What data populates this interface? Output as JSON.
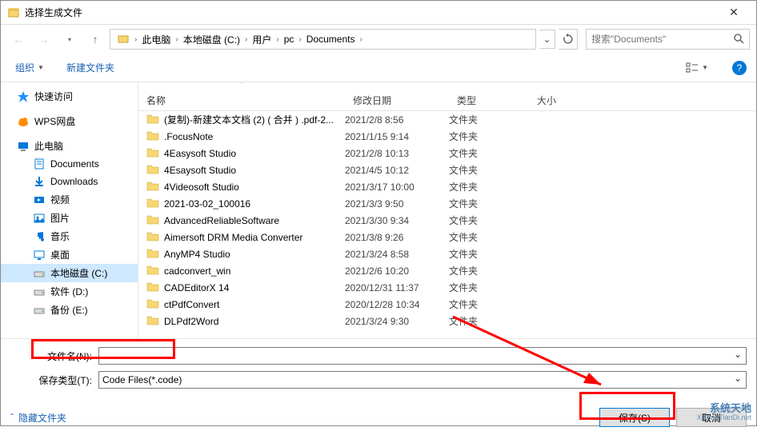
{
  "window": {
    "title": "选择生成文件"
  },
  "breadcrumb": {
    "segments": [
      "此电脑",
      "本地磁盘 (C:)",
      "用户",
      "pc",
      "Documents"
    ]
  },
  "search": {
    "placeholder": "搜索\"Documents\""
  },
  "toolbar": {
    "organize": "组织",
    "new_folder": "新建文件夹"
  },
  "sidebar": {
    "items": [
      {
        "label": "快速访问",
        "icon": "star",
        "color": "#1e90ff",
        "indent": false
      },
      {
        "label": "WPS网盘",
        "icon": "cloud",
        "color": "#ff8c00",
        "indent": false
      },
      {
        "label": "此电脑",
        "icon": "pc",
        "color": "#0078d7",
        "indent": false
      },
      {
        "label": "Documents",
        "icon": "doc",
        "color": "#0078d7",
        "indent": true
      },
      {
        "label": "Downloads",
        "icon": "down",
        "color": "#0078d7",
        "indent": true
      },
      {
        "label": "视频",
        "icon": "video",
        "color": "#0078d7",
        "indent": true
      },
      {
        "label": "图片",
        "icon": "pic",
        "color": "#0078d7",
        "indent": true
      },
      {
        "label": "音乐",
        "icon": "music",
        "color": "#0078d7",
        "indent": true
      },
      {
        "label": "桌面",
        "icon": "desktop",
        "color": "#0078d7",
        "indent": true
      },
      {
        "label": "本地磁盘 (C:)",
        "icon": "drive",
        "color": "#888",
        "indent": true,
        "selected": true
      },
      {
        "label": "软件 (D:)",
        "icon": "drive",
        "color": "#888",
        "indent": true
      },
      {
        "label": "备份 (E:)",
        "icon": "drive",
        "color": "#888",
        "indent": true
      }
    ]
  },
  "columns": {
    "name": "名称",
    "date": "修改日期",
    "type": "类型",
    "size": "大小"
  },
  "files": [
    {
      "name": "(复制)-新建文本文档 (2) ( 合并 ) .pdf-2...",
      "date": "2021/2/8 8:56",
      "type": "文件夹"
    },
    {
      "name": ".FocusNote",
      "date": "2021/1/15 9:14",
      "type": "文件夹"
    },
    {
      "name": "4Easysoft Studio",
      "date": "2021/2/8 10:13",
      "type": "文件夹"
    },
    {
      "name": "4Esaysoft Studio",
      "date": "2021/4/5 10:12",
      "type": "文件夹"
    },
    {
      "name": "4Videosoft Studio",
      "date": "2021/3/17 10:00",
      "type": "文件夹"
    },
    {
      "name": "2021-03-02_100016",
      "date": "2021/3/3 9:50",
      "type": "文件夹"
    },
    {
      "name": "AdvancedReliableSoftware",
      "date": "2021/3/30 9:34",
      "type": "文件夹"
    },
    {
      "name": "Aimersoft DRM Media Converter",
      "date": "2021/3/8 9:26",
      "type": "文件夹"
    },
    {
      "name": "AnyMP4 Studio",
      "date": "2021/3/24 8:58",
      "type": "文件夹"
    },
    {
      "name": "cadconvert_win",
      "date": "2021/2/6 10:20",
      "type": "文件夹"
    },
    {
      "name": "CADEditorX 14",
      "date": "2020/12/31 11:37",
      "type": "文件夹"
    },
    {
      "name": "ctPdfConvert",
      "date": "2020/12/28 10:34",
      "type": "文件夹"
    },
    {
      "name": "DLPdf2Word",
      "date": "2021/3/24 9:30",
      "type": "文件夹"
    }
  ],
  "form": {
    "filename_label": "文件名(N):",
    "filename_value": "",
    "filetype_label": "保存类型(T):",
    "filetype_value": "Code Files(*.code)"
  },
  "actions": {
    "hide_folders": "隐藏文件夹",
    "save": "保存(S)",
    "cancel": "取消"
  },
  "watermark": {
    "main": "系统天地",
    "sub": "XiTongTianDi.net"
  }
}
